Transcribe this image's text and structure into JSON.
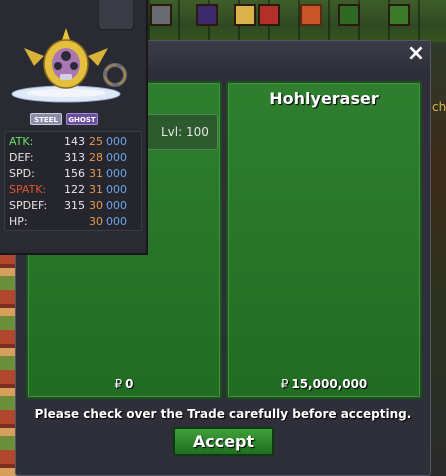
{
  "trade": {
    "close_label": "×",
    "left_panel": {
      "money_symbol": "₽",
      "money": "0",
      "item": {
        "level_label": "Lvl: 100"
      }
    },
    "right_panel": {
      "name": "Hohlyeraser",
      "money_symbol": "₽",
      "money": "15,000,000"
    },
    "notice": "Please check over the Trade carefully before accepting.",
    "accept_label": "Accept"
  },
  "pokemon_tooltip": {
    "types": [
      "STEEL",
      "GHOST"
    ],
    "stats": [
      {
        "name": "ATK:",
        "base": "143",
        "iv": "25",
        "ev": "000",
        "color": "#6be06b"
      },
      {
        "name": "DEF:",
        "base": "313",
        "iv": "28",
        "ev": "000",
        "color": "#e6e6e6"
      },
      {
        "name": "SPD:",
        "base": "156",
        "iv": "31",
        "ev": "000",
        "color": "#e6e6e6"
      },
      {
        "name": "SPATK:",
        "base": "122",
        "iv": "31",
        "ev": "000",
        "color": "#e2552e"
      },
      {
        "name": "SPDEF:",
        "base": "315",
        "iv": "30",
        "ev": "000",
        "color": "#e6e6e6"
      },
      {
        "name": "HP:",
        "base": "",
        "iv": "30",
        "ev": "000",
        "color": "#e6e6e6"
      }
    ]
  },
  "background": {
    "side_text": "ch"
  },
  "colors": {
    "panel_green": "#2f7f2f",
    "window_bg": "#2e2f39",
    "accept_green": "#3fa03a",
    "iv_orange": "#e69b47",
    "ev_blue": "#6fa6e8"
  }
}
